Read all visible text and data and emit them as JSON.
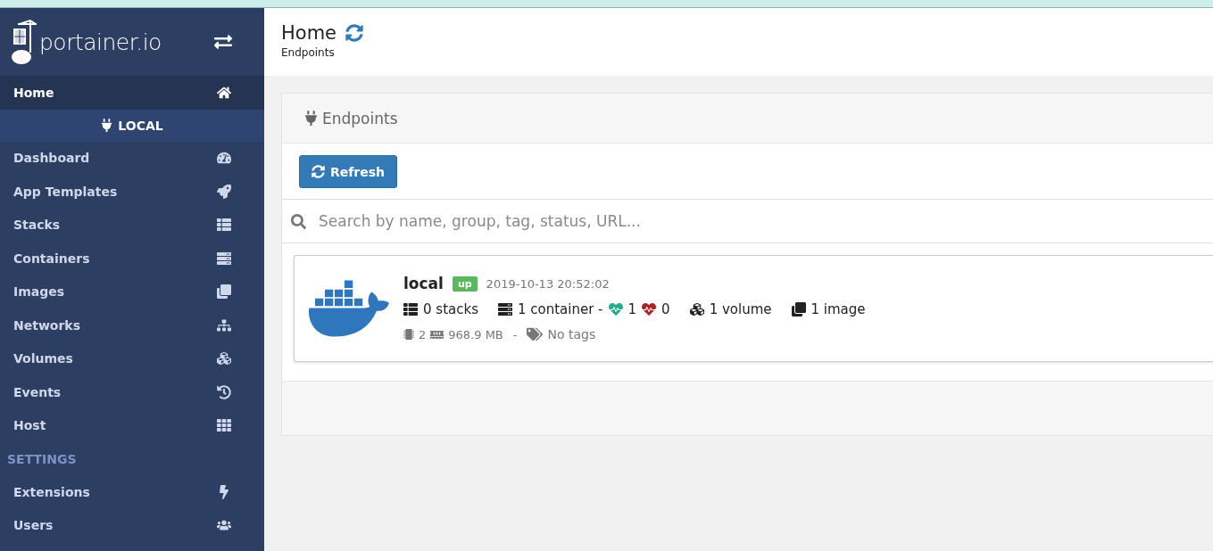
{
  "sidebar": {
    "brand": "portainer.io",
    "home_items": [
      {
        "label": "Home",
        "selected": true
      }
    ],
    "endpoint_heading": "LOCAL",
    "endpoint_items": [
      {
        "label": "Dashboard",
        "selected": false
      },
      {
        "label": "App Templates",
        "selected": false
      },
      {
        "label": "Stacks",
        "selected": false
      },
      {
        "label": "Containers",
        "selected": false
      },
      {
        "label": "Images",
        "selected": false
      },
      {
        "label": "Networks",
        "selected": false
      },
      {
        "label": "Volumes",
        "selected": false
      },
      {
        "label": "Events",
        "selected": false
      },
      {
        "label": "Host",
        "selected": false
      }
    ],
    "settings_heading": "SETTINGS",
    "settings_items": [
      {
        "label": "Extensions",
        "selected": false
      },
      {
        "label": "Users",
        "selected": false
      }
    ]
  },
  "header": {
    "title": "Home",
    "breadcrumb": "Endpoints"
  },
  "panel": {
    "title": "Endpoints",
    "refresh_button": "Refresh",
    "search": {
      "placeholder": "Search by name, group, tag, status, URL..."
    },
    "endpoints": [
      {
        "name": "local",
        "status": "up",
        "date": "2019-10-13 20:52:02",
        "stacks": "0 stacks",
        "containers": "1 container -",
        "healthy": "1",
        "unhealthy": "0",
        "volumes": "1 volume",
        "images": "1 image",
        "cpus": "2",
        "memory": "968.9 MB",
        "separator": "-",
        "tags": "No tags"
      }
    ]
  }
}
